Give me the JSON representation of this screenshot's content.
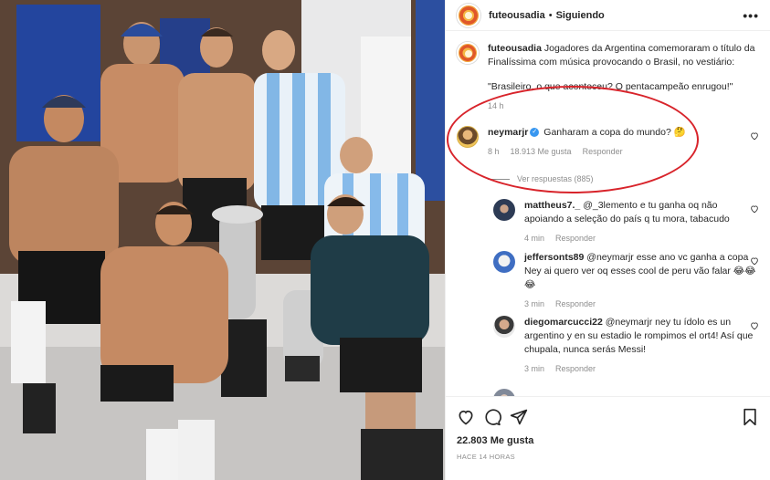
{
  "post": {
    "username": "futeousadia",
    "separator": "•",
    "follow_status": "Siguiendo",
    "more_label": "•••"
  },
  "caption": {
    "username": "futeousadia",
    "text": "Jogadores da Argentina comemoraram o título da Finalíssima com música provocando o Brasil, no vestiário:",
    "quote": "\"Brasileiro, o que aconteceu? O pentacampeão enrugou!\"",
    "time": "14 h"
  },
  "comments": [
    {
      "username": "neymarjr",
      "verified_mark": "✓",
      "text": "Ganharam a copa do mundo? 🤔",
      "time": "8 h",
      "likes": "18.913 Me gusta",
      "reply_label": "Responder",
      "view_replies": "Ver respuestas (885)"
    },
    {
      "username": "mattheus7._",
      "text": "@_3lemento e tu ganha oq não apoiando a seleção do país q tu mora, tabacudo",
      "time": "4 min",
      "reply_label": "Responder"
    },
    {
      "username": "jeffersonts89",
      "text": "@neymarjr esse ano vc ganha a copa Ney ai quero ver oq esses cool de peru vão falar 😂😂😂",
      "time": "3 min",
      "reply_label": "Responder"
    },
    {
      "username": "diegomarcucci22",
      "text": "@neymarjr ney tu ídolo es un argentino y en su estadio le rompimos el ort4! Así que chupala, nunca serás Messi!",
      "time": "3 min",
      "reply_label": "Responder"
    }
  ],
  "footer": {
    "likes": "22.803 Me gusta",
    "posted": "HACE 14 HORAS"
  },
  "icons": {
    "like": "heart-icon",
    "comment": "comment-icon",
    "share": "share-icon",
    "save": "bookmark-icon"
  },
  "colors": {
    "annotation": "#d8242b",
    "verified": "#3897f0",
    "muted": "#8e8e8e",
    "text": "#262626"
  }
}
